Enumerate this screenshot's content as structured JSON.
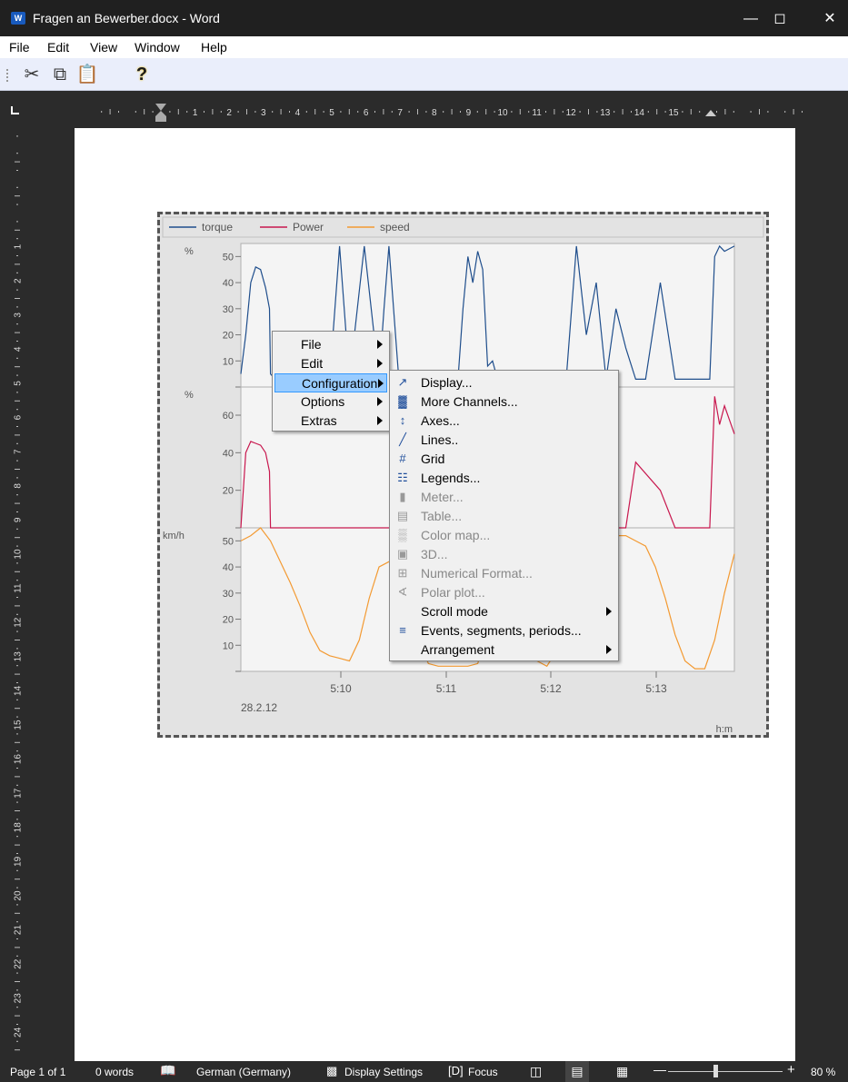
{
  "window": {
    "title": "Fragen an Bewerber.docx - Word",
    "app_icon": "W"
  },
  "menubar": [
    "File",
    "Edit",
    "View",
    "Window",
    "Help"
  ],
  "toolbar": {
    "icons": [
      "cut-icon",
      "copy-icon",
      "paste-icon",
      "help-icon"
    ]
  },
  "ruler": {
    "h_labels": [
      "1",
      "2",
      "3",
      "4",
      "5",
      "6",
      "7",
      "8",
      "9",
      "10",
      "11",
      "12",
      "13",
      "14",
      "15"
    ],
    "v_labels": [
      "1",
      "2",
      "3",
      "4",
      "5",
      "6",
      "7",
      "8",
      "9",
      "10",
      "11",
      "12",
      "13",
      "14",
      "15",
      "16",
      "17",
      "18",
      "19",
      "20",
      "21",
      "22",
      "23",
      "24"
    ]
  },
  "chart_data": {
    "type": "line",
    "legend": [
      {
        "name": "torque",
        "color": "#1f4e8c"
      },
      {
        "name": "Power",
        "color": "#c8174e"
      },
      {
        "name": "speed",
        "color": "#f39a32"
      }
    ],
    "panels": [
      {
        "unit": "%",
        "ticks": [
          "50",
          "40",
          "30",
          "20",
          "10"
        ],
        "ylim": [
          0,
          55
        ]
      },
      {
        "unit": "%",
        "ticks": [
          "60",
          "40",
          "20"
        ],
        "ylim": [
          0,
          75
        ]
      },
      {
        "unit": "km/h",
        "ticks": [
          "50",
          "40",
          "30",
          "20",
          "10"
        ],
        "ylim": [
          0,
          55
        ]
      }
    ],
    "x_ticks": [
      "5:10",
      "5:11",
      "5:12",
      "5:13"
    ],
    "date": "28.2.12",
    "xlabel": "h:m",
    "series": [
      {
        "name": "torque",
        "panel": 0,
        "x": [
          0,
          1,
          2,
          3,
          4,
          5,
          5.8,
          6,
          7,
          9,
          10,
          13,
          15,
          17,
          18,
          20,
          22,
          25,
          28,
          29,
          30,
          32,
          33,
          35,
          36,
          37,
          38,
          40,
          44,
          45,
          46,
          47,
          48,
          49,
          50,
          51,
          52,
          53,
          55,
          58,
          60,
          62,
          64,
          66,
          68,
          70,
          72,
          74,
          76,
          78,
          80,
          82,
          85,
          88,
          90,
          92,
          94,
          95,
          96,
          97,
          98,
          100
        ],
        "y": [
          5,
          20,
          40,
          46,
          45,
          38,
          30,
          5,
          3,
          3,
          3,
          3,
          3,
          3,
          3,
          54,
          3,
          54,
          3,
          30,
          54,
          3,
          3,
          3,
          3,
          3,
          3,
          3,
          3,
          30,
          50,
          40,
          52,
          45,
          8,
          10,
          3,
          3,
          3,
          3,
          3,
          3,
          3,
          5,
          54,
          20,
          40,
          3,
          30,
          15,
          3,
          3,
          40,
          3,
          3,
          3,
          3,
          3,
          50,
          54,
          52,
          54
        ]
      },
      {
        "name": "Power",
        "panel": 1,
        "x": [
          0,
          1,
          2,
          3,
          4,
          5,
          5.8,
          6,
          10,
          13,
          15,
          17,
          18,
          20,
          22,
          25,
          28,
          30,
          33,
          40,
          44,
          45,
          46,
          47,
          48,
          49,
          50,
          52,
          55,
          60,
          66,
          68,
          70,
          72,
          74,
          76,
          78,
          80,
          85,
          88,
          90,
          92,
          94,
          95,
          96,
          97,
          98,
          100
        ],
        "y": [
          0,
          40,
          46,
          45,
          44,
          40,
          30,
          0,
          0,
          0,
          0,
          0,
          0,
          0,
          0,
          0,
          0,
          0,
          0,
          0,
          0,
          0,
          0,
          0,
          0,
          0,
          0,
          0,
          0,
          0,
          0,
          0,
          0,
          0,
          0,
          0,
          0,
          35,
          20,
          0,
          0,
          0,
          0,
          0,
          70,
          55,
          65,
          50
        ]
      },
      {
        "name": "speed",
        "panel": 2,
        "x": [
          0,
          2,
          4,
          6,
          8,
          10,
          12,
          14,
          16,
          18,
          20,
          22,
          24,
          26,
          28,
          30,
          32,
          34,
          36,
          38,
          40,
          42,
          44,
          46,
          48,
          50,
          52,
          54,
          56,
          58,
          60,
          62,
          64,
          66,
          68,
          70,
          72,
          74,
          76,
          78,
          80,
          82,
          84,
          86,
          88,
          90,
          92,
          94,
          96,
          98,
          100
        ],
        "y": [
          50,
          52,
          55,
          50,
          42,
          34,
          25,
          15,
          8,
          6,
          5,
          4,
          12,
          28,
          40,
          42,
          41,
          30,
          12,
          3,
          2,
          2,
          2,
          2,
          3,
          15,
          30,
          33,
          28,
          12,
          4,
          2,
          8,
          22,
          38,
          42,
          48,
          50,
          52,
          52,
          50,
          48,
          40,
          28,
          14,
          4,
          1,
          1,
          12,
          30,
          45
        ]
      }
    ]
  },
  "context_menu": {
    "items": [
      {
        "label": "File",
        "submenu": true
      },
      {
        "label": "Edit",
        "submenu": true
      },
      {
        "label": "Configuration",
        "submenu": true,
        "selected": true
      },
      {
        "label": "Options",
        "submenu": true
      },
      {
        "label": "Extras",
        "submenu": true
      }
    ]
  },
  "submenu": {
    "items": [
      {
        "label": "Display...",
        "icon": "display-icon",
        "enabled": true
      },
      {
        "label": "More Channels...",
        "icon": "channels-icon",
        "enabled": true
      },
      {
        "label": "Axes...",
        "icon": "axes-icon",
        "enabled": true
      },
      {
        "label": "Lines..",
        "icon": "lines-icon",
        "enabled": true
      },
      {
        "label": "Grid",
        "icon": "grid-icon",
        "enabled": true
      },
      {
        "label": "Legends...",
        "icon": "legends-icon",
        "enabled": true
      },
      {
        "label": "Meter...",
        "icon": "meter-icon",
        "enabled": false
      },
      {
        "label": "Table...",
        "icon": "table-icon",
        "enabled": false
      },
      {
        "label": "Color map...",
        "icon": "colormap-icon",
        "enabled": false
      },
      {
        "label": "3D...",
        "icon": "3d-icon",
        "enabled": false
      },
      {
        "label": "Numerical Format...",
        "icon": "numformat-icon",
        "enabled": false
      },
      {
        "label": "Polar plot...",
        "icon": "polar-icon",
        "enabled": false
      },
      {
        "label": "Scroll mode",
        "icon": "",
        "enabled": true,
        "submenu": true
      },
      {
        "label": "Events, segments, periods...",
        "icon": "events-icon",
        "enabled": true
      },
      {
        "label": "Arrangement",
        "icon": "",
        "enabled": true,
        "submenu": true
      }
    ]
  },
  "status": {
    "page": "Page 1 of 1",
    "words": "0 words",
    "language": "German (Germany)",
    "display_settings": "Display Settings",
    "focus": "Focus",
    "zoom": "80 %"
  }
}
